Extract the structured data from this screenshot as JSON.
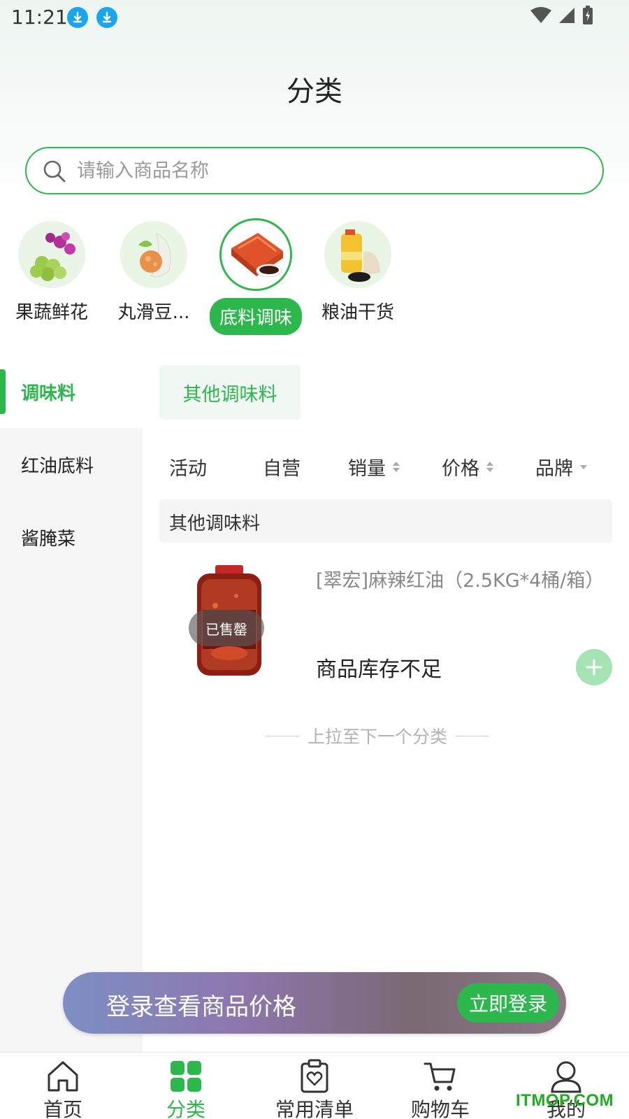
{
  "status_bar": {
    "time": "11:21"
  },
  "header": {
    "title": "分类"
  },
  "search": {
    "placeholder": "请输入商品名称"
  },
  "categories": [
    {
      "label": "果蔬鲜花",
      "active": false
    },
    {
      "label": "丸滑豆...",
      "active": false
    },
    {
      "label": "底料调味",
      "active": true
    },
    {
      "label": "粮油干货",
      "active": false
    }
  ],
  "sidebar": {
    "items": [
      {
        "label": "调味料",
        "active": true
      },
      {
        "label": "红油底料",
        "active": false
      },
      {
        "label": "酱腌菜",
        "active": false
      }
    ]
  },
  "sub_tab": {
    "label": "其他调味料"
  },
  "filters": [
    {
      "label": "活动"
    },
    {
      "label": "自营"
    },
    {
      "label": "销量"
    },
    {
      "label": "价格"
    },
    {
      "label": "品牌"
    }
  ],
  "section": {
    "title": "其他调味料"
  },
  "product": {
    "name": "[翠宏]麻辣红油（2.5KG*4桶/箱）",
    "badge": "已售罄",
    "stock_note": "商品库存不足"
  },
  "pull_hint": "上拉至下一个分类",
  "login_banner": {
    "text": "登录查看商品价格",
    "button": "立即登录"
  },
  "bottom_nav": [
    {
      "label": "首页",
      "icon": "home-icon"
    },
    {
      "label": "分类",
      "icon": "category-icon",
      "active": true
    },
    {
      "label": "常用清单",
      "icon": "list-icon"
    },
    {
      "label": "购物车",
      "icon": "cart-icon"
    },
    {
      "label": "我的",
      "icon": "user-icon"
    }
  ],
  "watermark": "ITMOP.COM",
  "colors": {
    "accent": "#2db84d",
    "download_icon": "#1aa6ee"
  }
}
